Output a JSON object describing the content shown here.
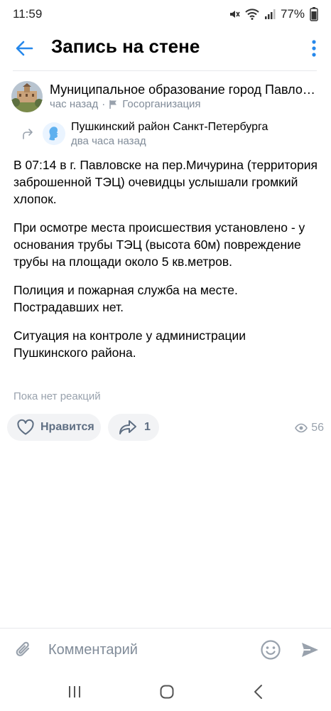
{
  "status_bar": {
    "time": "11:59",
    "battery": "77%",
    "icons": [
      "mute-icon",
      "wifi-icon",
      "signal-icon",
      "battery-icon"
    ]
  },
  "header": {
    "title": "Запись на стене",
    "back_icon": "arrow-left-icon",
    "menu_icon": "more-vertical-icon"
  },
  "post": {
    "author": "Муниципальное образование город Павловск",
    "time": "час назад",
    "separator": "·",
    "category": "Госорганизация",
    "repost": {
      "source": "Пушкинский район Санкт-Петербурга",
      "time": "два часа назад"
    },
    "paragraphs": [
      "В 07:14 в г. Павловске на пер.Мичурина (территория заброшенной ТЭЦ) очевидцы услышали громкий хлопок.",
      "При осмотре места происшествия установлено - у основания трубы ТЭЦ (высота 60м) повреждение трубы на площади около 5 кв.метров.",
      "Полиция и пожарная служба на месте. Пострадавших нет.",
      "Ситуация на контроле у администрации Пушкинского района."
    ],
    "reactions_text": "Пока нет реакций",
    "like_label": "Нравится",
    "shares": "1",
    "views": "56"
  },
  "comment_bar": {
    "placeholder": "Комментарий"
  },
  "colors": {
    "accent": "#2688eb",
    "secondary_text": "#818c99",
    "button_bg": "#f2f3f5"
  }
}
